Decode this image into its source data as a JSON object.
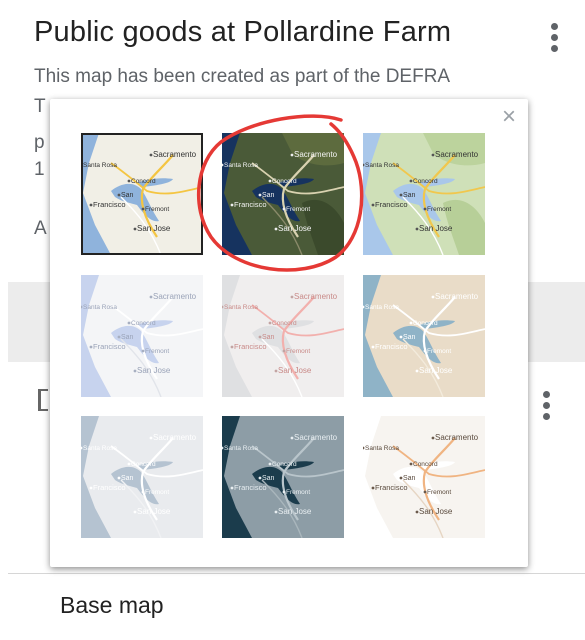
{
  "header": {
    "title": "Public goods at Pollardine Farm",
    "description": "This map has been created as part of the DEFRA",
    "fragments": [
      "T",
      "p",
      "1",
      "A"
    ]
  },
  "basemap_section": {
    "label": "Base map"
  },
  "popup": {
    "close_symbol": "×",
    "selected_tile": "tile-light-political",
    "annotated_tile": "tile-satellite",
    "annotation_color": "#e53935",
    "tiles": [
      {
        "name": "tile-light-political",
        "style": "road",
        "labels": [
          "Sacramento",
          "Santa Rosa",
          "Concord",
          "San",
          "Francisco",
          "Fremont",
          "San Jose"
        ]
      },
      {
        "name": "tile-satellite",
        "style": "satellite",
        "labels": [
          "Sacramento",
          "Santa Rosa",
          "Concord",
          "San",
          "Francisco",
          "Fremont",
          "San Jose"
        ]
      },
      {
        "name": "tile-terrain",
        "style": "terrain",
        "labels": [
          "Sacramento",
          "Santa Rosa",
          "Concord",
          "San",
          "Francisco",
          "Fremont",
          "San Jose"
        ]
      },
      {
        "name": "tile-light-grey",
        "style": "lightblue",
        "labels": [
          "Sacramento",
          "Santa Rosa",
          "Concord",
          "San",
          "Francisco",
          "Fremont",
          "San Jose"
        ]
      },
      {
        "name": "tile-light-grey-red",
        "style": "lightgrey",
        "labels": [
          "Sacramento",
          "Santa Rosa",
          "Concord",
          "San",
          "Francisco",
          "Fremont",
          "San Jose"
        ]
      },
      {
        "name": "tile-mono-city",
        "style": "beige",
        "labels": [
          "Sacramento",
          "Santa Rosa",
          "Concord",
          "San",
          "Francisco",
          "Fremont",
          "San Jose"
        ]
      },
      {
        "name": "tile-simple-atlas",
        "style": "greyblue",
        "labels": [
          "Sacramento",
          "Santa Rosa",
          "Concord",
          "San",
          "Francisco",
          "Fremont",
          "San Jose"
        ]
      },
      {
        "name": "tile-dark-landmass",
        "style": "dark",
        "labels": [
          "Sacramento",
          "Santa Rosa",
          "Concord",
          "San",
          "Francisco",
          "Fremont",
          "San Jose"
        ]
      },
      {
        "name": "tile-white-water",
        "style": "white",
        "labels": [
          "Sacramento",
          "Santa Rosa",
          "Concord",
          "San",
          "Francisco",
          "Fremont",
          "San Jose"
        ]
      }
    ]
  }
}
